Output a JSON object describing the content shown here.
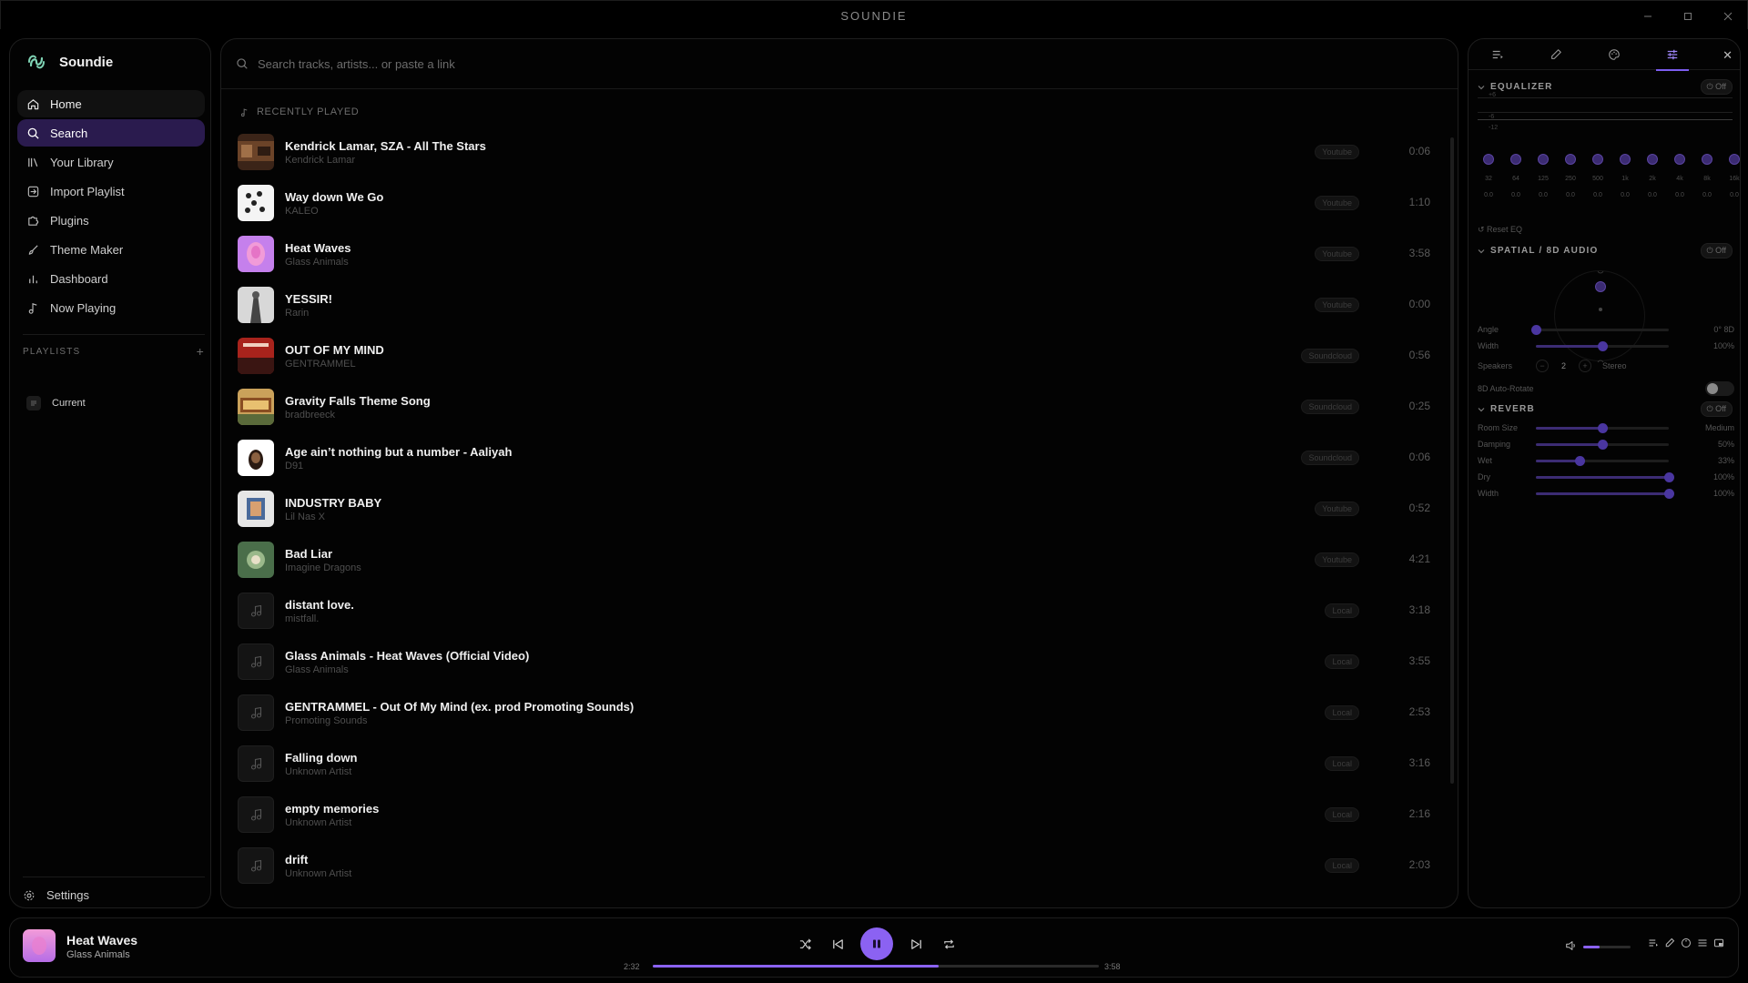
{
  "window": {
    "title": "SOUNDIE",
    "controls": [
      "minimize-icon",
      "maximize-icon",
      "close-icon"
    ]
  },
  "sidebar": {
    "brand": "Soundie",
    "items": [
      {
        "label": "Home",
        "icon": "home-icon",
        "state": "hover"
      },
      {
        "label": "Search",
        "icon": "search-icon",
        "state": "active"
      },
      {
        "label": "Your Library",
        "icon": "library-icon"
      },
      {
        "label": "Import Playlist",
        "icon": "import-icon"
      },
      {
        "label": "Plugins",
        "icon": "puzzle-icon"
      },
      {
        "label": "Theme Maker",
        "icon": "brush-icon"
      },
      {
        "label": "Dashboard",
        "icon": "chart-icon"
      },
      {
        "label": "Now Playing",
        "icon": "music-note-icon"
      }
    ],
    "playlists_heading": "PLAYLISTS",
    "playlists": [
      {
        "label": "Current"
      }
    ],
    "settings_label": "Settings"
  },
  "search": {
    "placeholder": "Search tracks, artists... or paste a link",
    "value": ""
  },
  "main": {
    "section_title": "RECENTLY PLAYED",
    "tracks": [
      {
        "title": "Kendrick Lamar, SZA - All The Stars",
        "artist": "Kendrick Lamar",
        "source": "Youtube",
        "duration": "0:06",
        "thumb": "art-1"
      },
      {
        "title": "Way down We Go",
        "artist": "KALEO",
        "source": "Youtube",
        "duration": "1:10",
        "thumb": "art-2"
      },
      {
        "title": "Heat Waves",
        "artist": "Glass Animals",
        "source": "Youtube",
        "duration": "3:58",
        "thumb": "art-3"
      },
      {
        "title": "YESSIR!",
        "artist": "Rarin",
        "source": "Youtube",
        "duration": "0:00",
        "thumb": "art-4"
      },
      {
        "title": "OUT OF MY MIND",
        "artist": "GENTRAMMEL",
        "source": "Soundcloud",
        "duration": "0:56",
        "thumb": "art-5"
      },
      {
        "title": "Gravity Falls Theme Song",
        "artist": "bradbreeck",
        "source": "Soundcloud",
        "duration": "0:25",
        "thumb": "art-6"
      },
      {
        "title": "Age ain’t nothing but a number - Aaliyah",
        "artist": "D91",
        "source": "Soundcloud",
        "duration": "0:06",
        "thumb": "art-7"
      },
      {
        "title": "INDUSTRY BABY",
        "artist": "Lil Nas X",
        "source": "Youtube",
        "duration": "0:52",
        "thumb": "art-8"
      },
      {
        "title": "Bad Liar",
        "artist": "Imagine Dragons",
        "source": "Youtube",
        "duration": "4:21",
        "thumb": "art-9"
      },
      {
        "title": "distant love.",
        "artist": "mistfall.",
        "source": "Local",
        "duration": "3:18",
        "thumb": "placeholder"
      },
      {
        "title": "Glass Animals - Heat Waves (Official Video)",
        "artist": "Glass Animals",
        "source": "Local",
        "duration": "3:55",
        "thumb": "placeholder"
      },
      {
        "title": "GENTRAMMEL - Out Of My Mind (ex. prod Promoting Sounds)",
        "artist": "Promoting Sounds",
        "source": "Local",
        "duration": "2:53",
        "thumb": "placeholder"
      },
      {
        "title": "Falling down",
        "artist": "Unknown Artist",
        "source": "Local",
        "duration": "3:16",
        "thumb": "placeholder"
      },
      {
        "title": "empty memories",
        "artist": "Unknown Artist",
        "source": "Local",
        "duration": "2:16",
        "thumb": "placeholder"
      },
      {
        "title": "drift",
        "artist": "Unknown Artist",
        "source": "Local",
        "duration": "2:03",
        "thumb": "placeholder"
      }
    ]
  },
  "right_panel": {
    "tabs": [
      "queue-icon",
      "lyrics-icon",
      "theme-icon",
      "equalizer-icon"
    ],
    "active_tab": "equalizer-icon",
    "equalizer": {
      "title": "EQUALIZER",
      "toggle": "Off",
      "scale": [
        "+6",
        "-6",
        "-12"
      ],
      "bands": [
        "32",
        "64",
        "125",
        "250",
        "500",
        "1k",
        "2k",
        "4k",
        "8k",
        "16k"
      ],
      "values": [
        "0.0",
        "0.0",
        "0.0",
        "0.0",
        "0.0",
        "0.0",
        "0.0",
        "0.0",
        "0.0",
        "0.0"
      ],
      "reset_label": "Reset EQ"
    },
    "spatial": {
      "title": "SPATIAL / 8D AUDIO",
      "toggle": "Off",
      "controls": [
        {
          "label": "Angle",
          "value": "0° 8D",
          "level": 0.0
        },
        {
          "label": "Width",
          "value": "100%",
          "level": 0.5
        }
      ],
      "speakers_label": "Speakers",
      "speakers_value": "2",
      "speakers_mode": "Stereo",
      "autorotate_label": "8D Auto-Rotate"
    },
    "reverb": {
      "title": "REVERB",
      "toggle": "Off",
      "controls": [
        {
          "label": "Room Size",
          "value": "Medium",
          "level": 0.5
        },
        {
          "label": "Damping",
          "value": "50%",
          "level": 0.5
        },
        {
          "label": "Wet",
          "value": "33%",
          "level": 0.33
        },
        {
          "label": "Dry",
          "value": "100%",
          "level": 1.0
        },
        {
          "label": "Width",
          "value": "100%",
          "level": 1.0
        }
      ]
    }
  },
  "player": {
    "title": "Heat Waves",
    "artist": "Glass Animals",
    "current_time": "2:32",
    "total_time": "3:58",
    "progress": 0.64,
    "volume": 0.35,
    "accent": "#8b62f2"
  }
}
